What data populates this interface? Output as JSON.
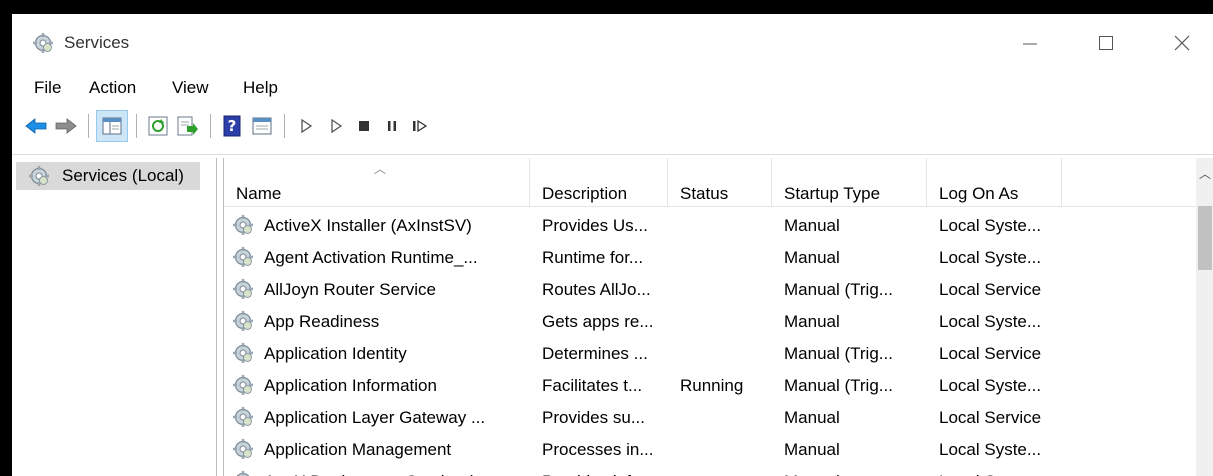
{
  "window": {
    "title": "Services"
  },
  "menu": [
    "File",
    "Action",
    "View",
    "Help"
  ],
  "tree": {
    "selected_label": "Services (Local)"
  },
  "columns": [
    "Name",
    "Description",
    "Status",
    "Startup Type",
    "Log On As"
  ],
  "rows": [
    {
      "name": "ActiveX Installer (AxInstSV)",
      "description": "Provides Us...",
      "status": "",
      "startup": "Manual",
      "logon": "Local Syste..."
    },
    {
      "name": "Agent Activation Runtime_...",
      "description": "Runtime for...",
      "status": "",
      "startup": "Manual",
      "logon": "Local Syste..."
    },
    {
      "name": "AllJoyn Router Service",
      "description": "Routes AllJo...",
      "status": "",
      "startup": "Manual (Trig...",
      "logon": "Local Service"
    },
    {
      "name": "App Readiness",
      "description": "Gets apps re...",
      "status": "",
      "startup": "Manual",
      "logon": "Local Syste..."
    },
    {
      "name": "Application Identity",
      "description": "Determines ...",
      "status": "",
      "startup": "Manual (Trig...",
      "logon": "Local Service"
    },
    {
      "name": "Application Information",
      "description": "Facilitates t...",
      "status": "Running",
      "startup": "Manual (Trig...",
      "logon": "Local Syste..."
    },
    {
      "name": "Application Layer Gateway ...",
      "description": "Provides su...",
      "status": "",
      "startup": "Manual",
      "logon": "Local Service"
    },
    {
      "name": "Application Management",
      "description": "Processes in...",
      "status": "",
      "startup": "Manual",
      "logon": "Local Syste..."
    },
    {
      "name": "AppX Deployment Service (...",
      "description": "Provides inf...",
      "status": "",
      "startup": "Manual",
      "logon": "Local Syste..."
    }
  ],
  "toolbar_icons": [
    "back-icon",
    "forward-icon",
    "show-tree-icon",
    "refresh-icon",
    "export-list-icon",
    "help-icon",
    "properties-icon",
    "start-icon",
    "start-alt-icon",
    "stop-icon",
    "pause-icon",
    "resume-icon"
  ],
  "colors": {
    "selection": "#d9d9d9",
    "accent_blue": "#1e90ff",
    "toolbar_active": "#cde6f7"
  }
}
